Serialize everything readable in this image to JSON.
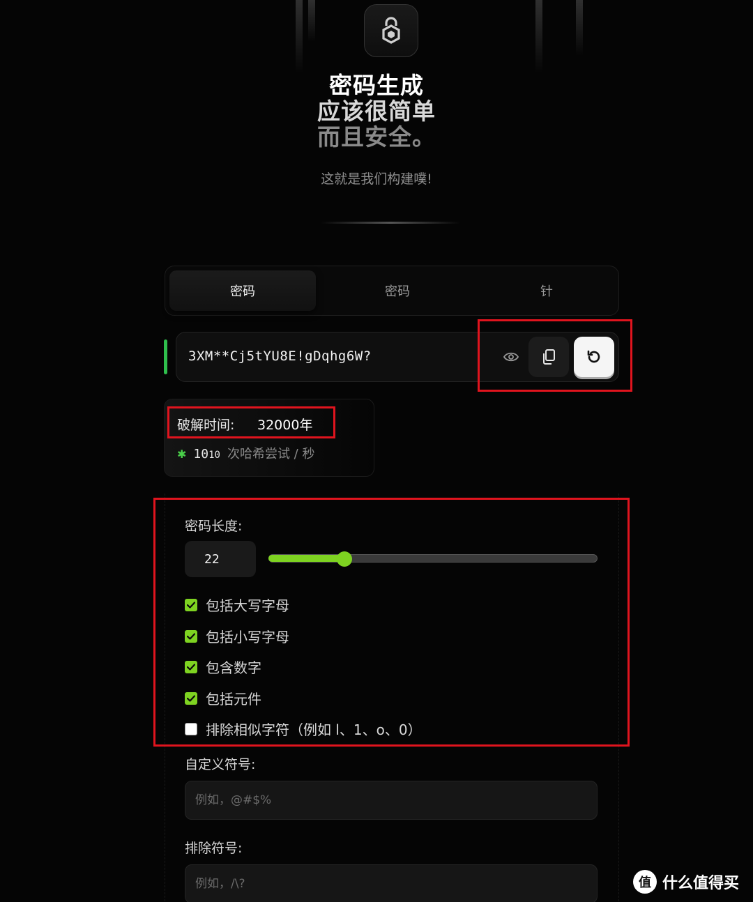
{
  "hero": {
    "line1": "密码生成",
    "line2": "应该很简单",
    "line3": "而且安全。",
    "subtitle": "这就是我们构建噗!"
  },
  "tabs": [
    {
      "label": "密码",
      "active": true
    },
    {
      "label": "密码",
      "active": false
    },
    {
      "label": "针",
      "active": false
    }
  ],
  "password": {
    "value": "3XM**Cj5tYU8E!gDqhg6W?",
    "icons": [
      "eye-icon",
      "copy-icon",
      "refresh-icon"
    ]
  },
  "crack": {
    "label": "破解时间:",
    "value": "32000年",
    "rate_base": "10",
    "rate_exp": "10",
    "rate_text": "次哈希尝试 / 秒"
  },
  "length": {
    "label": "密码长度:",
    "value": "22",
    "slider_fraction": 0.23
  },
  "options": [
    {
      "label": "包括大写字母",
      "checked": true
    },
    {
      "label": "包括小写字母",
      "checked": true
    },
    {
      "label": "包含数字",
      "checked": true
    },
    {
      "label": "包括元件",
      "checked": true
    },
    {
      "label": "排除相似字符（例如 l、1、o、0）",
      "checked": false
    }
  ],
  "custom_symbols": {
    "label": "自定义符号:",
    "placeholder": "例如，@#$%"
  },
  "exclude_symbols": {
    "label": "排除符号:",
    "placeholder": "例如，/\\?"
  },
  "watermark": {
    "icon": "值",
    "text": "什么值得买"
  },
  "colors": {
    "accent": "#7ed321",
    "highlight_box": "#e0141e",
    "strength_bar": "#2fbf4d"
  }
}
